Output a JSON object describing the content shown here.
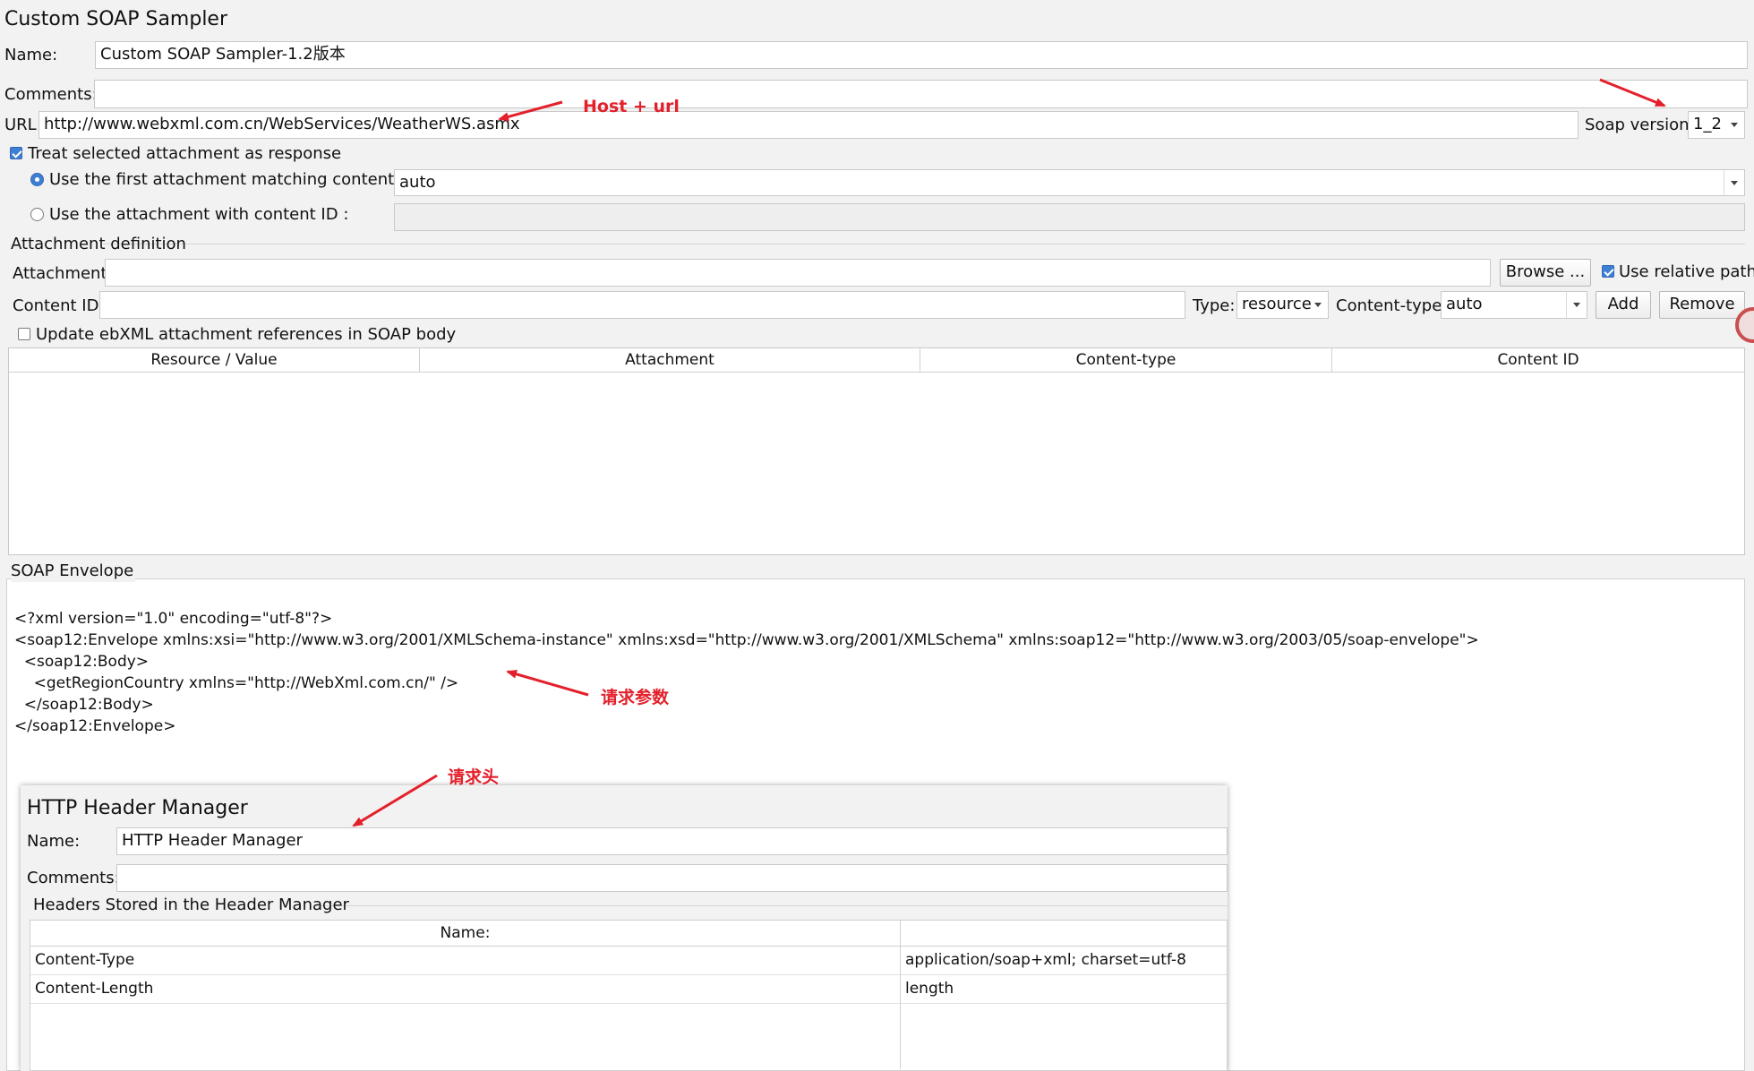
{
  "sampler": {
    "title": "Custom SOAP Sampler",
    "name_label": "Name:",
    "name_value": "Custom SOAP Sampler-1.2版本",
    "comments_label": "Comments:",
    "comments_value": "",
    "url_label": "URL",
    "url_value": "http://www.webxml.com.cn/WebServices/WeatherWS.asmx",
    "soap_version_label": "Soap version",
    "soap_version_value": "1_2",
    "treat_attachment_label": "Treat selected attachment as response",
    "treat_attachment_checked": true,
    "first_attachment_label": "Use the first attachment matching content-type :",
    "first_attachment_value": "auto",
    "content_id_radio_label": "Use the attachment with content ID :",
    "content_id_radio_value": ""
  },
  "attachment_definition": {
    "legend": "Attachment definition",
    "attachment_label": "Attachment:",
    "attachment_value": "",
    "browse_label": "Browse ...",
    "relative_paths_label": "Use relative paths",
    "relative_paths_checked": true,
    "content_id_label": "Content ID:",
    "content_id_value": "",
    "type_label": "Type:",
    "type_value": "resource",
    "content_type_label": "Content-type:",
    "content_type_value": "auto",
    "add_label": "Add",
    "remove_label": "Remove",
    "update_ebxml_label": "Update ebXML attachment references in SOAP body",
    "update_ebxml_checked": false,
    "table_headers": [
      "Resource / Value",
      "Attachment",
      "Content-type",
      "Content ID"
    ]
  },
  "soap_envelope": {
    "legend": "SOAP Envelope",
    "lines": [
      "<?xml version=\"1.0\" encoding=\"utf-8\"?>",
      "<soap12:Envelope xmlns:xsi=\"http://www.w3.org/2001/XMLSchema-instance\" xmlns:xsd=\"http://www.w3.org/2001/XMLSchema\" xmlns:soap12=\"http://www.w3.org/2003/05/soap-envelope\">",
      "  <soap12:Body>",
      "    <getRegionCountry xmlns=\"http://WebXml.com.cn/\" />",
      "  </soap12:Body>",
      "</soap12:Envelope>"
    ]
  },
  "header_manager": {
    "title": "HTTP Header Manager",
    "name_label": "Name:",
    "name_value": "HTTP Header Manager",
    "comments_label": "Comments:",
    "comments_value": "",
    "legend": "Headers Stored in the Header Manager",
    "col_name": "Name:",
    "col_value": "",
    "rows": [
      {
        "name": "Content-Type",
        "value": "application/soap+xml; charset=utf-8"
      },
      {
        "name": "Content-Length",
        "value": "length"
      }
    ]
  },
  "annotations": {
    "host_url": "Host + url",
    "request_params": "请求参数",
    "request_header": "请求头"
  },
  "colors": {
    "annotation": "#e3202b",
    "accent": "#3f7fd2"
  }
}
